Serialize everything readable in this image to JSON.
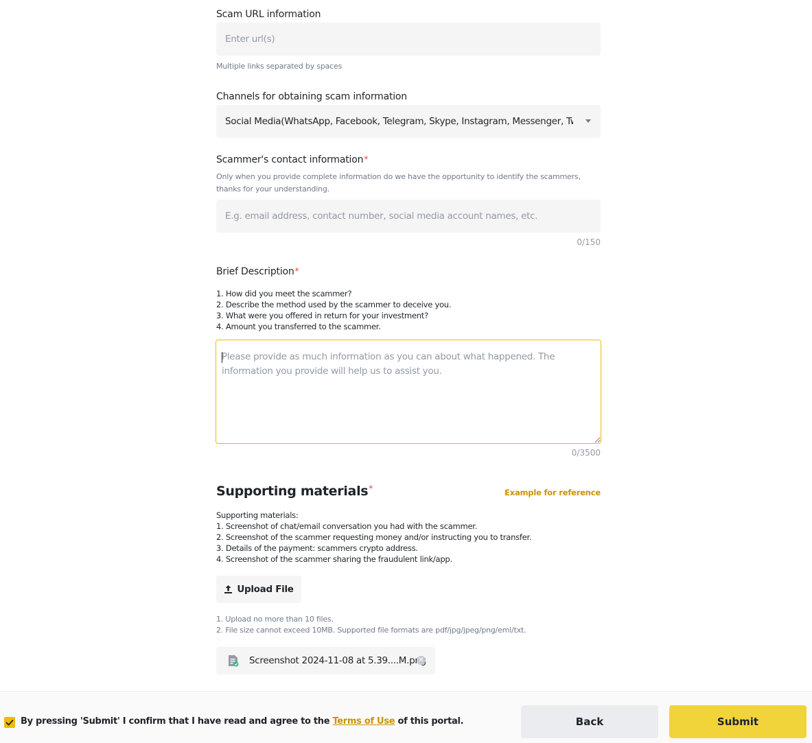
{
  "url_section": {
    "label": "Scam URL information",
    "placeholder": "Enter url(s)",
    "value": "",
    "hint": "Multiple links separated by spaces"
  },
  "channel_section": {
    "label": "Channels for obtaining scam information",
    "selected": "Social Media(WhatsApp, Facebook, Telegram, Skype, Instagram, Messenger, Twitter)"
  },
  "contact_section": {
    "label": "Scammer's contact information",
    "required_mark": "*",
    "hint": "Only when you provide complete information do we have the opportunity to identify the scammers, thanks for your understanding.",
    "placeholder": "E.g. email address, contact number, social media account names, etc.",
    "value": "",
    "counter": "0/150"
  },
  "description_section": {
    "label": "Brief Description",
    "required_mark": "*",
    "questions": [
      "1. How did you meet the scammer?",
      "2. Describe the method used by the scammer to deceive you.",
      "3. What were you offered in return for your investment?",
      "4. Amount you transferred to the scammer."
    ],
    "placeholder": "Please provide as much information as you can about what happened. The information you provide will help us to assist you.",
    "value": "",
    "counter": "0/3500"
  },
  "materials_section": {
    "title": "Supporting materials",
    "required_mark": "*",
    "reference_link": "Example for reference",
    "intro": "Supporting materials:",
    "items": [
      "1. Screenshot of chat/email conversation you had with the scammer.",
      "2. Screenshot of the scammer requesting money and/or instructing you to transfer.",
      "3. Details of the payment: scammers crypto address.",
      "4. Screenshot of the scammer sharing the fraudulent link/app."
    ],
    "upload_label": "Upload File",
    "upload_icon": "upload-icon",
    "rules": [
      "1. Upload no more than 10 files.",
      "2. File size cannot exceed 10MB. Supported file formats are pdf/jpg/jpeg/png/eml/txt."
    ],
    "files": [
      {
        "name": "Screenshot 2024-11-08 at 5.39....M.png",
        "icon": "image-file-icon"
      }
    ]
  },
  "footer": {
    "checked": true,
    "agree_prefix": "By pressing 'Submit' I confirm that I have read and agree to the ",
    "terms_link": "Terms of Use",
    "agree_suffix": " of this portal.",
    "back_label": "Back",
    "submit_label": "Submit",
    "colors": {
      "accent": "#f0b90b",
      "submit": "#f0d43a",
      "link": "#c99400",
      "required": "#e34141"
    }
  }
}
